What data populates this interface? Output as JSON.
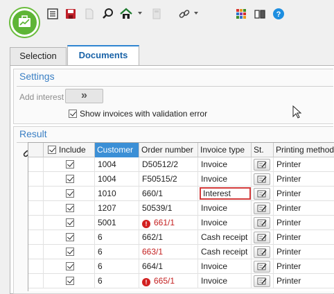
{
  "toolbar": {
    "icons": [
      "app-logo-icon",
      "list-icon",
      "save-icon",
      "document-icon",
      "search-icon",
      "home-icon",
      "calculator-icon",
      "link-icon",
      "windows-icon",
      "book-icon",
      "help-icon"
    ],
    "colors": {
      "logo": "#5eb536",
      "save": "#c0202a",
      "help": "#1d8ee0"
    }
  },
  "tabs": [
    {
      "label": "Selection",
      "active": false
    },
    {
      "label": "Documents",
      "active": true
    }
  ],
  "settings": {
    "title": "Settings",
    "add_interest_label": "Add interest",
    "add_interest_button": "»",
    "show_invoices_checked": true,
    "show_invoices_label": "Show invoices with validation error"
  },
  "result": {
    "title": "Result",
    "columns": [
      "Include",
      "Customer",
      "Order number",
      "Invoice type",
      "St.",
      "Printing method"
    ],
    "sorted_column": "Customer",
    "rows": [
      {
        "include": true,
        "customer": "1004",
        "order": "D50512/2",
        "type": "Invoice",
        "print": "Printer",
        "error": false,
        "highlight": false
      },
      {
        "include": true,
        "customer": "1004",
        "order": "F50515/2",
        "type": "Invoice",
        "print": "Printer",
        "error": false,
        "highlight": false
      },
      {
        "include": true,
        "customer": "1010",
        "order": "660/1",
        "type": "Interest",
        "print": "Printer",
        "error": false,
        "highlight": true
      },
      {
        "include": true,
        "customer": "1207",
        "order": "50539/1",
        "type": "Invoice",
        "print": "Printer",
        "error": false,
        "highlight": false
      },
      {
        "include": true,
        "customer": "5001",
        "order": "661/1",
        "type": "Invoice",
        "print": "Printer",
        "error": true,
        "error_icon": true,
        "highlight": false
      },
      {
        "include": true,
        "customer": "6",
        "order": "662/1",
        "type": "Cash receipt",
        "print": "Printer",
        "error": false,
        "highlight": false
      },
      {
        "include": true,
        "customer": "6",
        "order": "663/1",
        "type": "Cash receipt",
        "print": "Printer",
        "error": true,
        "error_icon": false,
        "highlight": false
      },
      {
        "include": true,
        "customer": "6",
        "order": "664/1",
        "type": "Invoice",
        "print": "Printer",
        "error": false,
        "highlight": false
      },
      {
        "include": true,
        "customer": "6",
        "order": "665/1",
        "type": "Invoice",
        "print": "Printer",
        "error": true,
        "error_icon": true,
        "highlight": false
      }
    ],
    "error_glyph": "!",
    "colors": {
      "sorted_header": "#3b8fd6",
      "error_text": "#c42020",
      "highlight_border": "#d33a3a"
    }
  }
}
